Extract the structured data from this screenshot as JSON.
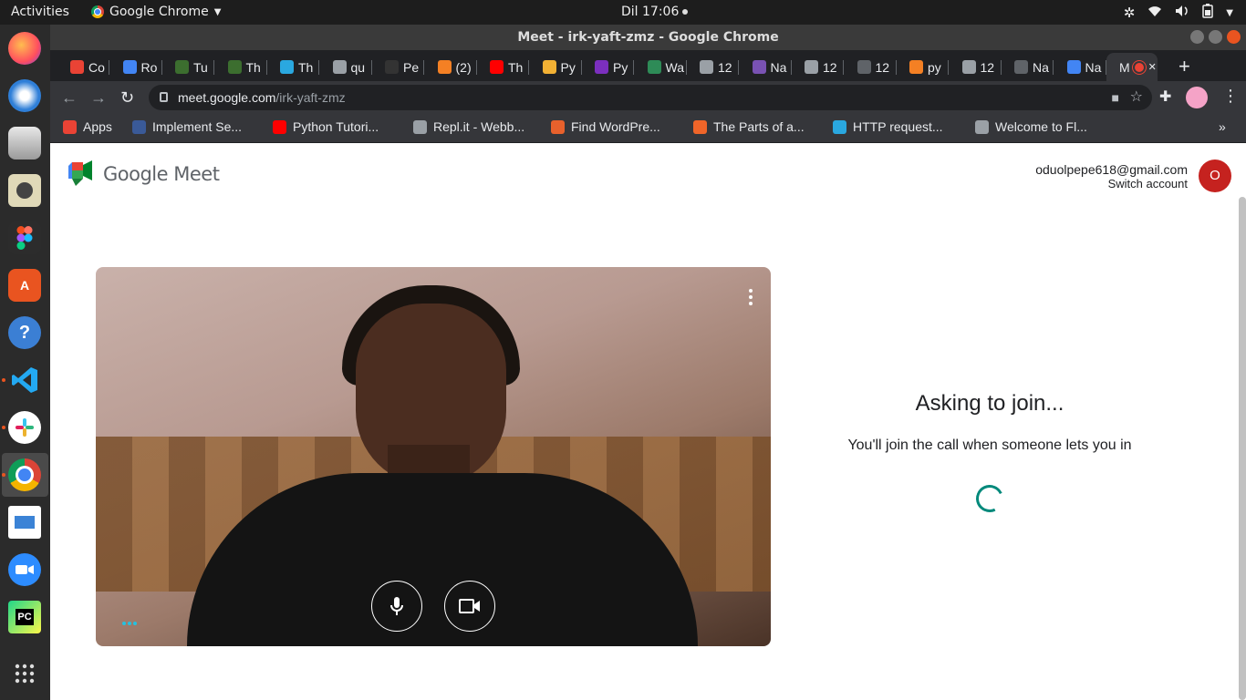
{
  "topbar": {
    "activities": "Activities",
    "app_name": "Google Chrome",
    "clock": "Dil 17:06"
  },
  "window": {
    "title": "Meet - irk-yaft-zmz - Google Chrome"
  },
  "tabs": [
    {
      "label": "Co",
      "fav": "#ea4335"
    },
    {
      "label": "Ro",
      "fav": "#4285f4"
    },
    {
      "label": "Tu",
      "fav": "#3c6e2f"
    },
    {
      "label": "Th",
      "fav": "#3c6e2f"
    },
    {
      "label": "Th",
      "fav": "#2aa8e0"
    },
    {
      "label": "qu",
      "fav": "#9aa0a6"
    },
    {
      "label": "Pe",
      "fav": "#333333"
    },
    {
      "label": "(2)",
      "fav": "#f48024"
    },
    {
      "label": "Th",
      "fav": "#ff0000"
    },
    {
      "label": "Py",
      "fav": "#f2b134"
    },
    {
      "label": "Py",
      "fav": "#7b2fbe"
    },
    {
      "label": "Wa",
      "fav": "#2e8b57"
    },
    {
      "label": "12",
      "fav": "#9aa0a6"
    },
    {
      "label": "Na",
      "fav": "#7952b3"
    },
    {
      "label": "12",
      "fav": "#9aa0a6"
    },
    {
      "label": "12",
      "fav": "#5f6368"
    },
    {
      "label": "py",
      "fav": "#f48024"
    },
    {
      "label": "12",
      "fav": "#9aa0a6"
    },
    {
      "label": "Na",
      "fav": "#5f6368"
    },
    {
      "label": "Na",
      "fav": "#4285f4"
    },
    {
      "label": "M",
      "fav": "#ea4335",
      "active": true
    }
  ],
  "omnibox": {
    "host": "meet.google.com",
    "path": "/irk-yaft-zmz"
  },
  "bookmarks": [
    {
      "label": "Apps",
      "color": "#ea4335"
    },
    {
      "label": "Implement Se...",
      "color": "#3a5a98"
    },
    {
      "label": "Python Tutori...",
      "color": "#ff0000"
    },
    {
      "label": "Repl.it - Webb...",
      "color": "#9aa0a6"
    },
    {
      "label": "Find WordPre...",
      "color": "#e8612c"
    },
    {
      "label": "The Parts of a...",
      "color": "#f06529"
    },
    {
      "label": "HTTP request...",
      "color": "#2aa8e0"
    },
    {
      "label": "Welcome to Fl...",
      "color": "#9aa0a6"
    }
  ],
  "meet": {
    "logo_text": "Google Meet",
    "account_email": "oduolpepe618@gmail.com",
    "switch_account": "Switch account",
    "avatar_initial": "O",
    "status_title": "Asking to join...",
    "status_message": "You'll join the call when someone lets you in"
  },
  "icons": {
    "mic": "mic-icon",
    "camera": "videocam-icon",
    "more": "more-vert-icon"
  },
  "colors": {
    "meet_spinner": "#00897b",
    "avatar": "#c5221f"
  }
}
